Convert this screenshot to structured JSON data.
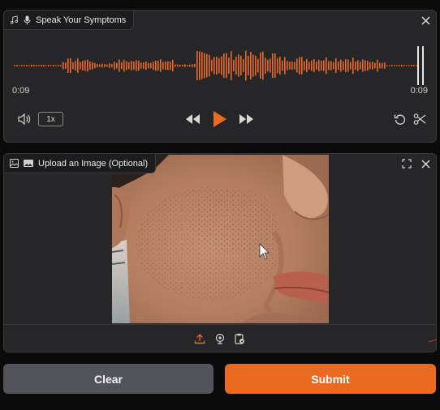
{
  "audio": {
    "label": "Speak Your Symptoms",
    "label_icon": "music-note-icon",
    "mic_icon": "microphone-icon",
    "current_time": "0:09",
    "total_time": "0:09",
    "speed": "1x",
    "playback_progress": 1.0,
    "accent_color": "#ea6a22"
  },
  "image_upload": {
    "label": "Upload an Image (Optional)",
    "label_icon": "image-icon",
    "source_icons": [
      "upload-icon",
      "webcam-icon",
      "clipboard-icon"
    ]
  },
  "actions": {
    "clear_label": "Clear",
    "submit_label": "Submit"
  }
}
